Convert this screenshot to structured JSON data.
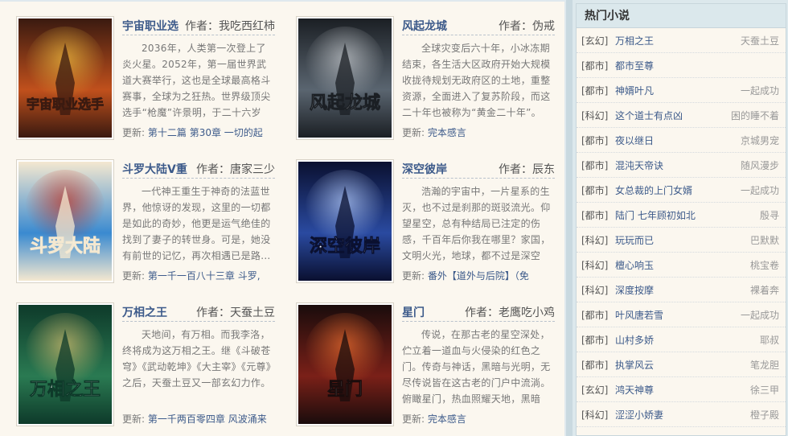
{
  "books": [
    {
      "title": "宇宙职业选",
      "author": "作者：我吃西红柿",
      "desc": "2036年，人类第一次登上了炎火星。2052年，第一届世界武道大赛举行，这也是全球最高格斗赛事，全球为之狂热。世界级顶尖选手“枪魔”许景明，于二十六岁那...",
      "update_label": "更新:",
      "update_text": "第十二篇 第30章 一切的起",
      "cover_text": "宇宙职业选手",
      "cover_colors": [
        "#3a1a10",
        "#c0501c",
        "#f0c040"
      ]
    },
    {
      "title": "风起龙城",
      "author": "作者：伪戒",
      "desc": "全球灾变后六十年，小冰冻期结束，各生活大区政府开始大规模收拢待规划无政府区的土地，重整资源，全面进入了复苏阶段，而这二十年也被称为“黄金二十年”。",
      "update_label": "更新:",
      "update_text": "完本感言",
      "cover_text": "风起龙城",
      "cover_colors": [
        "#1b1f24",
        "#5a6570",
        "#c8ccd0"
      ]
    },
    {
      "title": "斗罗大陆V重",
      "author": "作者：唐家三少",
      "desc": "一代神王重生于神奇的法蓝世界，他惊讶的发现，这里的一切都是如此的奇妙，他更是运气绝佳的找到了妻子的转世身。可是，她没有前世的记忆，再次相遇已是路...",
      "update_label": "更新:",
      "update_text": "第一千一百八十三章 斗罗,",
      "cover_text": "斗罗大陆",
      "cover_colors": [
        "#f4e8d0",
        "#3a8ad0",
        "#c03020"
      ]
    },
    {
      "title": "深空彼岸",
      "author": "作者：辰东",
      "desc": "浩瀚的宇宙中，一片星系的生灭，也不过是刹那的斑驳流光。仰望星空，总有种结局已注定的伤感，千百年后你我在哪里？家国，文明火光，地球，都不过是深空中...",
      "update_label": "更新:",
      "update_text": "番外【道外与后院】（免",
      "cover_text": "深空彼岸",
      "cover_colors": [
        "#0a1030",
        "#2a4aa0",
        "#b8d0ff"
      ]
    },
    {
      "title": "万相之王",
      "author": "作者：天蚕土豆",
      "desc": "天地间，有万相。而我李洛，终将成为这万相之王。继《斗破苍穹》《武动乾坤》《大主宰》《元尊》之后，天蚕土豆又一部玄幻力作。",
      "update_label": "更新:",
      "update_text": "第一千两百零四章 风波涌来",
      "cover_text": "万相之王",
      "cover_colors": [
        "#0e3a2a",
        "#2a7a52",
        "#d8c070"
      ]
    },
    {
      "title": "星门",
      "author": "作者：老鹰吃小鸡",
      "desc": "传说，在那古老的星空深处，伫立着一道血与火侵染的红色之门。传奇与神话，黑暗与光明，无尽传说皆在这古老的门户中流淌。俯瞰星门，热血照耀天地，黑暗终...",
      "update_label": "更新:",
      "update_text": "完本感言",
      "cover_text": "星门",
      "cover_colors": [
        "#1a0c0c",
        "#7a2018",
        "#f07030"
      ]
    }
  ],
  "sidebar": {
    "title": "热门小说",
    "items": [
      {
        "cat": "[玄幻]",
        "title": "万相之王",
        "author": "天蚕土豆"
      },
      {
        "cat": "[都市]",
        "title": "都市至尊",
        "author": ""
      },
      {
        "cat": "[都市]",
        "title": "神婿叶凡",
        "author": "一起成功"
      },
      {
        "cat": "[科幻]",
        "title": "这个道士有点凶",
        "author": "困的睡不着"
      },
      {
        "cat": "[都市]",
        "title": "夜以继日",
        "author": "京城男宠"
      },
      {
        "cat": "[都市]",
        "title": "混沌天帝诀",
        "author": "随风漫步"
      },
      {
        "cat": "[都市]",
        "title": "女总裁的上门女婿",
        "author": "一起成功"
      },
      {
        "cat": "[都市]",
        "title": "陆门 七年顾初如北",
        "author": "殷寻"
      },
      {
        "cat": "[科幻]",
        "title": "玩玩而已",
        "author": "巴默默"
      },
      {
        "cat": "[科幻]",
        "title": "檀心响玉",
        "author": "桃宝卷"
      },
      {
        "cat": "[科幻]",
        "title": "深度按摩",
        "author": "裸着奔"
      },
      {
        "cat": "[都市]",
        "title": "叶风唐若雪",
        "author": "一起成功"
      },
      {
        "cat": "[都市]",
        "title": "山村多娇",
        "author": "耶叔"
      },
      {
        "cat": "[都市]",
        "title": "执掌风云",
        "author": "笔龙胆"
      },
      {
        "cat": "[玄幻]",
        "title": "鸿天神尊",
        "author": "徐三甲"
      },
      {
        "cat": "[科幻]",
        "title": "涩涩小娇妻",
        "author": "橙子殿"
      }
    ]
  }
}
